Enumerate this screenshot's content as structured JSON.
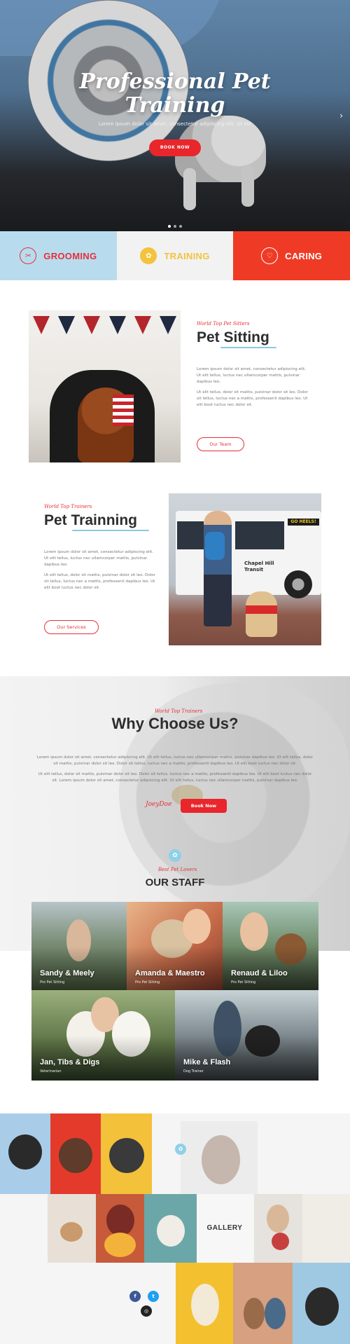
{
  "hero": {
    "title_line1": "Professional Pet",
    "title_line2": "Training",
    "subtitle": "Lorem ipsum dolor sit amet, consectetur adipiscing elit. Ut elit",
    "button": "BOOK NOW",
    "next_arrow": "›"
  },
  "services": [
    {
      "label": "GROOMING",
      "icon": "✂"
    },
    {
      "label": "TRAINING",
      "icon": "✿"
    },
    {
      "label": "CARING",
      "icon": "♡"
    }
  ],
  "pet_sitting": {
    "kicker": "World Top Pet Sitters",
    "title": "Pet Sitting",
    "para1": "Lorem ipsum dolor sit amet, consectetur adipiscing elit. Ut elit tellus, luctus nec ullamcorper mattis, pulvinar dapibus leo.",
    "para2": "Ut elit tellus, dolor sit mattis, pulvinar dolor sit leo. Dolor sit tellus, luctus nec a mattis, professenli dapibus leo. Ut elit boot luctus nec dolor sit.",
    "button": "Our Team"
  },
  "pet_training": {
    "kicker": "World Top Trainers",
    "title": "Pet Trainning",
    "para1": "Lorem ipsum dolor sit amet, consectetur adipiscing elit. Ut elit tellus, luctus nec ullamcorper mattis, pulvinar dapibus leo.",
    "para2": "Ut elit tellus, dolor sit mattis, pulvinar dolor sit leo. Dolor sit tellus, luctus nec a mattis, professenli dapibus leo. Ut elit boot luctus nec dolor sit.",
    "button": "Our Services",
    "bus_sign": "GO HEELS!",
    "bus_text": "Chapel Hill Transit"
  },
  "why": {
    "kicker": "World Top Trainers",
    "title": "Why Choose Us?",
    "para1": "Lorem ipsum dolor sit amet, consectetur adipiscing elit. Ut elit tellus, luctus nec ullamcorper mattis, pulvinar dapibus leo. Ut elit tellus, dolor sit mattis, pulvinar dolor sit leo. Dolor sit tellus, luctus nec a mattis, professenli dapibus leo. Ut elit boot luctus nec dolor sit.",
    "para2": "Ut elit tellus, dolor sit mattis, pulvinar dolor sit leo. Dolor sit tellus, luctus nec a mattis, professenli dapibus leo. Ut elit boot luctus nec dolor sit. Lorem ipsum dolor sit amet, consectetur adipiscing elit. Ut elit tellus, luctus nec ullamcorper mattis, pulvinar dapibus leo.",
    "signature": "JoeyDoe",
    "button": "Book Now"
  },
  "staff": {
    "kicker": "Best Pet Lovers",
    "title": "OUR STAFF",
    "members": [
      {
        "name": "Sandy & Meely",
        "role": "Pro Pet Sitting"
      },
      {
        "name": "Amanda & Maestro",
        "role": "Pro Pet Sitting"
      },
      {
        "name": "Renaud & Liloo",
        "role": "Pro Pet Sitting"
      },
      {
        "name": "Jan, Tibs & Digs",
        "role": "Veterinarian"
      },
      {
        "name": "Mike & Flash",
        "role": "Dog Trainer"
      }
    ]
  },
  "gallery": {
    "label": "GALLERY",
    "social": {
      "facebook": "f",
      "twitter": "t",
      "instagram": "◎"
    }
  }
}
